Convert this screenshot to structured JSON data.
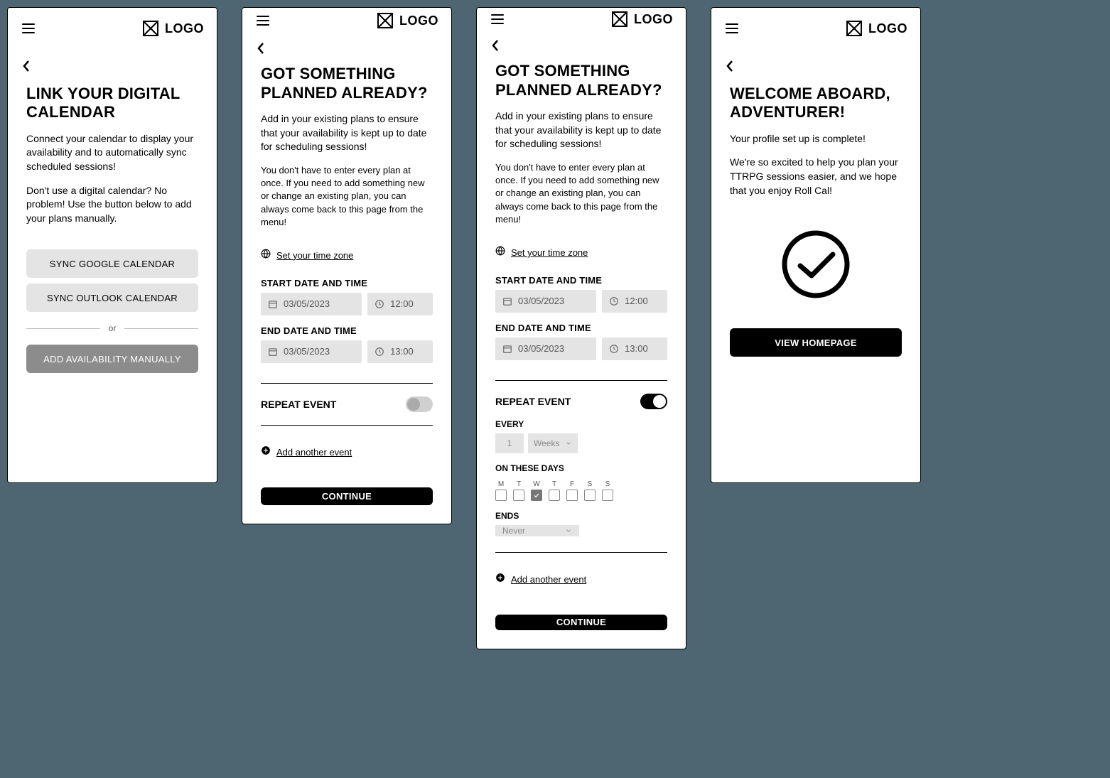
{
  "brand": {
    "logo_text": "LOGO"
  },
  "screen1": {
    "title": "LINK YOUR DIGITAL CALENDAR",
    "p1": "Connect your calendar to display your availability and to automatically sync scheduled sessions!",
    "p2": "Don't use a digital calendar? No problem! Use the button below to add your plans manually.",
    "btn_google": "SYNC GOOGLE CALENDAR",
    "btn_outlook": "SYNC OUTLOOK CALENDAR",
    "or_text": "or",
    "btn_manual": "ADD AVAILABILITY MANUALLY"
  },
  "screen2": {
    "title": "GOT SOMETHING PLANNED ALREADY?",
    "p1": "Add in your existing plans to ensure that your availability is kept up to date for scheduling sessions!",
    "p2": "You don't have to enter every plan at once. If you need to add something new or change an existing plan, you can always come back to this page from the menu!",
    "timezone_link": "Set your time zone",
    "start_label": "START DATE AND TIME",
    "end_label": "END DATE AND TIME",
    "start_date": "03/05/2023",
    "start_time": "12:00",
    "end_date": "03/05/2023",
    "end_time": "13:00",
    "repeat_label": "REPEAT EVENT",
    "repeat_on": false,
    "add_event": "Add another event",
    "continue": "CONTINUE"
  },
  "screen3": {
    "title": "GOT SOMETHING PLANNED ALREADY?",
    "p1": "Add in your existing plans to ensure that your availability is kept up to date for scheduling sessions!",
    "p2": "You don't have to enter every plan at once. If you need to add something new or change an existing plan, you can always come back to this page from the menu!",
    "timezone_link": "Set your time zone",
    "start_label": "START DATE AND TIME",
    "end_label": "END DATE AND TIME",
    "start_date": "03/05/2023",
    "start_time": "12:00",
    "end_date": "03/05/2023",
    "end_time": "13:00",
    "repeat_label": "REPEAT EVENT",
    "repeat_on": true,
    "every_label": "EVERY",
    "every_num": "1",
    "every_unit": "Weeks",
    "days_label": "ON THESE DAYS",
    "days": [
      "M",
      "T",
      "W",
      "T",
      "F",
      "S",
      "S"
    ],
    "days_checked_index": 2,
    "ends_label": "ENDS",
    "ends_value": "Never",
    "add_event": "Add another event",
    "continue": "CONTINUE"
  },
  "screen4": {
    "title": "WELCOME ABOARD, ADVENTURER!",
    "p1": "Your profile set up is complete!",
    "p2": "We're so excited to help you plan your TTRPG sessions easier, and we hope that you enjoy Roll Cal!",
    "btn": "VIEW HOMEPAGE"
  }
}
